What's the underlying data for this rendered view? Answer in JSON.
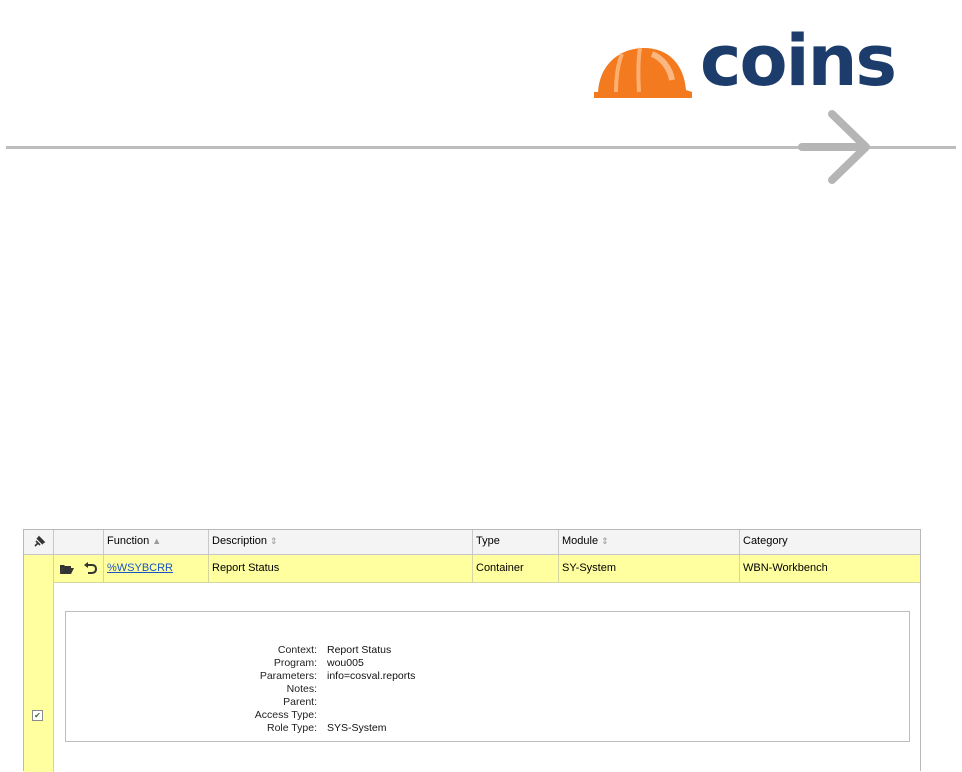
{
  "header": {
    "logo_text": "coins",
    "colors": {
      "brand_navy": "#1c3c6b",
      "hat_orange": "#f47a20",
      "rule_grey": "#bdbdbd",
      "row_highlight": "#ffffa0"
    }
  },
  "grid": {
    "columns": [
      {
        "key": "pin",
        "label": ""
      },
      {
        "key": "actions",
        "label": ""
      },
      {
        "key": "function",
        "label": "Function",
        "sort": "▲"
      },
      {
        "key": "description",
        "label": "Description",
        "sort": "⇕"
      },
      {
        "key": "type",
        "label": "Type"
      },
      {
        "key": "module",
        "label": "Module",
        "sort": "⇕"
      },
      {
        "key": "category",
        "label": "Category"
      }
    ],
    "row": {
      "function": "%WSYBCRR",
      "description": "Report Status",
      "type": "Container",
      "module": "SY-System",
      "category": "WBN-Workbench",
      "icons": [
        "folder-open-icon",
        "undo-icon"
      ]
    },
    "detail": {
      "fields": [
        {
          "label": "Context:",
          "value": "Report Status"
        },
        {
          "label": "Program:",
          "value": "wou005"
        },
        {
          "label": "Parameters:",
          "value": "info=cosval.reports"
        },
        {
          "label": "Notes:",
          "value": ""
        },
        {
          "label": "Parent:",
          "value": ""
        },
        {
          "label": "Access Type:",
          "value": ""
        },
        {
          "label": "Role Type:",
          "value": "SYS-System"
        }
      ]
    }
  }
}
